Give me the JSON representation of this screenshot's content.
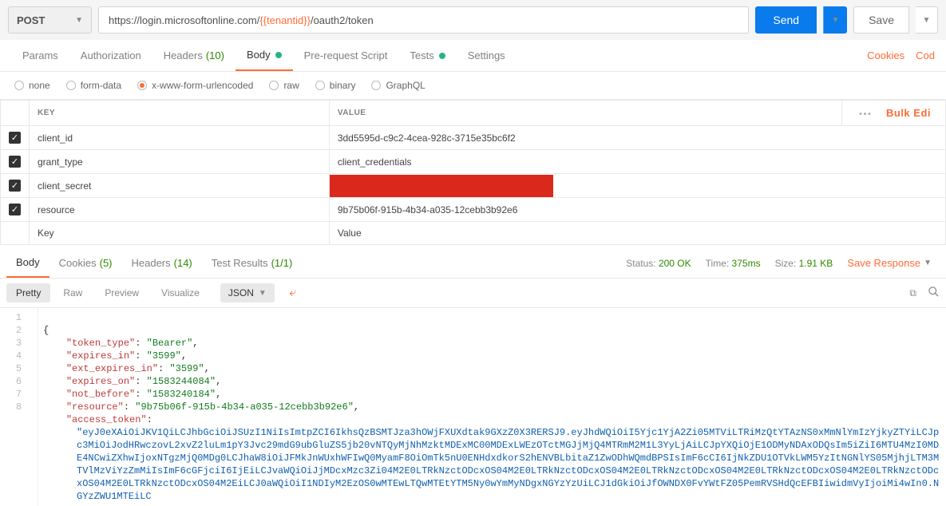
{
  "request": {
    "method": "POST",
    "url_prefix": "https://login.microsoftonline.com/",
    "url_var": "{{tenantid}}",
    "url_suffix": "/oauth2/token",
    "send_label": "Send",
    "save_label": "Save"
  },
  "req_tabs": {
    "params": "Params",
    "auth": "Authorization",
    "headers": "Headers",
    "headers_count": "(10)",
    "body": "Body",
    "prerequest": "Pre-request Script",
    "tests": "Tests",
    "settings": "Settings"
  },
  "right_links": {
    "cookies": "Cookies",
    "code": "Cod"
  },
  "body_types": {
    "none": "none",
    "formdata": "form-data",
    "xwww": "x-www-form-urlencoded",
    "raw": "raw",
    "binary": "binary",
    "graphql": "GraphQL"
  },
  "kv": {
    "key_header": "KEY",
    "value_header": "VALUE",
    "bulk_edit": "Bulk Edi",
    "rows": [
      {
        "key": "client_id",
        "value": "3dd5595d-c9c2-4cea-928c-3715e35bc6f2",
        "redacted": false
      },
      {
        "key": "grant_type",
        "value": "client_credentials",
        "redacted": false
      },
      {
        "key": "client_secret",
        "value": "",
        "redacted": true
      },
      {
        "key": "resource",
        "value": "9b75b06f-915b-4b34-a035-12cebb3b92e6",
        "redacted": false
      }
    ],
    "key_placeholder": "Key",
    "value_placeholder": "Value"
  },
  "resp_tabs": {
    "body": "Body",
    "cookies": "Cookies",
    "cookies_count": "(5)",
    "headers": "Headers",
    "headers_count": "(14)",
    "tests": "Test Results",
    "tests_count": "(1/1)"
  },
  "resp_meta": {
    "status_lbl": "Status:",
    "status": "200 OK",
    "time_lbl": "Time:",
    "time": "375ms",
    "size_lbl": "Size:",
    "size": "1.91 KB",
    "save_resp": "Save Response"
  },
  "viewbar": {
    "pretty": "Pretty",
    "raw": "Raw",
    "preview": "Preview",
    "visualize": "Visualize",
    "format": "JSON"
  },
  "response_body": {
    "token_type": "Bearer",
    "expires_in": "3599",
    "ext_expires_in": "3599",
    "expires_on": "1583244084",
    "not_before": "1583240184",
    "resource": "9b75b06f-915b-4b34-a035-12cebb3b92e6",
    "access_token_key": "access_token",
    "access_token": "eyJ0eXAiOiJKV1QiLCJhbGciOiJSUzI1NiIsImtpZCI6IkhsQzBSMTJza3hOWjFXUXdtak9GXzZ0X3RERSJ9.eyJhdWQiOiI5Yjc1YjA2Zi05MTViLTRiMzQtYTAzNS0xMmNlYmIzYjkyZTYiLCJpc3MiOiJodHRwczovL2xvZ2luLm1pY3Jvc29mdG9ubGluZS5jb20vNTQyMjNhMzktMDExMC00MDExLWEzOTctMGJjMjQ4MTRmM2M1L3YyLjAiLCJpYXQiOjE1ODMyNDAxODQsIm5iZiI6MTU4MzI0MDE4NCwiZXhwIjoxNTgzMjQ0MDg0LCJhaW8iOiJFMkJnWUxhWFIwQ0MyamF8OiOmTk5nU0ENHdxdkorS2hENVBLbitaZ1ZwODhWQmdBPSIsImF6cCI6IjNkZDU1OTVkLWM5YzItNGNlYS05MjhjLTM3MTVlMzViYzZmMiIsImF6cGFjciI6IjEiLCJvaWQiOiJjMDcxMzc3Zi04M2E0LTRkNzctODcxOS04M2E0LTRkNzctODcxOS04M2E0LTRkNzctODcxOS04M2E0LTRkNzctODcxOS04M2E0LTRkNzctODcxOS04M2E0LTRkNzctODcxOS04M2EiLCJ0aWQiOiI1NDIyM2EzOS0wMTEwLTQwMTEtYTM5Ny0wYmMyNDgxNGYzYzUiLCJ1dGkiOiJfOWNDX0FvYWtFZ05PemRVSHdQcEFBIiwidmVyIjoiMi4wIn0.NGYzZWU1MTEiLC"
  }
}
